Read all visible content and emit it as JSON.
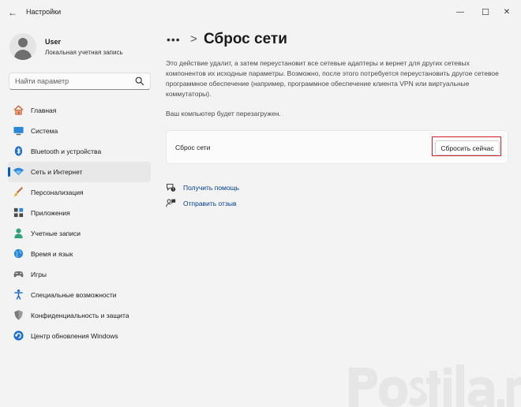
{
  "window": {
    "title": "Настройки",
    "back_icon": "←",
    "minimize_icon": "—",
    "maximize_icon": "☐",
    "close_icon": "✕"
  },
  "user": {
    "name": "User",
    "account_type": "Локальная учетная запись"
  },
  "search": {
    "placeholder": "Найти параметр"
  },
  "sidebar": {
    "items": [
      {
        "label": "Главная",
        "icon": "home-icon"
      },
      {
        "label": "Система",
        "icon": "system-icon"
      },
      {
        "label": "Bluetooth и устройства",
        "icon": "bluetooth-icon"
      },
      {
        "label": "Сеть и Интернет",
        "icon": "network-icon",
        "active": true
      },
      {
        "label": "Персонализация",
        "icon": "brush-icon"
      },
      {
        "label": "Приложения",
        "icon": "apps-icon"
      },
      {
        "label": "Учетные записи",
        "icon": "accounts-icon"
      },
      {
        "label": "Время и язык",
        "icon": "globe-icon"
      },
      {
        "label": "Игры",
        "icon": "gamepad-icon"
      },
      {
        "label": "Специальные возможности",
        "icon": "accessibility-icon"
      },
      {
        "label": "Конфиденциальность и защита",
        "icon": "shield-icon"
      },
      {
        "label": "Центр обновления Windows",
        "icon": "update-icon"
      }
    ]
  },
  "breadcrumb": {
    "dots": "•••",
    "separator": ">",
    "title": "Сброс сети"
  },
  "main": {
    "description": "Это действие удалит, а затем переустановит все сетевые адаптеры и вернет для других сетевых компонентов их исходные параметры. Возможно, после этого потребуется переустановить другое сетевое программное обеспечение (например, программное обеспечение клиента VPN или виртуальные коммутаторы).",
    "reboot_note": "Ваш компьютер будет перезагружен.",
    "card": {
      "label": "Сброс сети",
      "button_label": "Сбросить сейчас"
    },
    "links": [
      {
        "label": "Получить помощь",
        "icon": "help-icon"
      },
      {
        "label": "Отправить отзыв",
        "icon": "feedback-icon"
      }
    ]
  },
  "watermark": {
    "text": "Postila.ru"
  },
  "colors": {
    "accent": "#005fb8",
    "highlight": "#d0242a",
    "link": "#003e92",
    "background": "#f3f3f3"
  }
}
